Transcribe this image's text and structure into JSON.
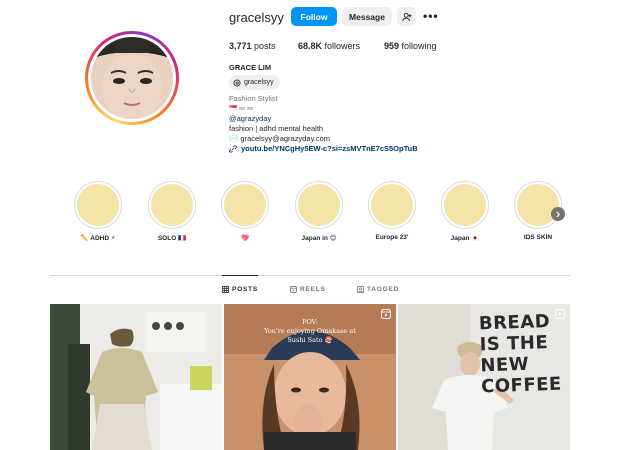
{
  "profile": {
    "username": "gracelsyy",
    "full_name": "GRACE LIM",
    "threads_handle": "gracelsyy",
    "category": "Fashion Stylist",
    "flag_emoji": "🇸🇬",
    "mention": "@agrazyday",
    "bio_line_1": "fashion | adhd mental health",
    "bio_line_2": "✉️ gracelsyy@agrazyday.com",
    "link": "youtu.be/YNCgHy5EW-c?si=zsMVTnE7cS5OpTuB"
  },
  "buttons": {
    "follow": "Follow",
    "message": "Message",
    "more": "•••"
  },
  "stats": {
    "posts_count": "3,771",
    "posts_label": " posts",
    "followers_count": "68.8K",
    "followers_label": " followers",
    "following_count": "959",
    "following_label": " following"
  },
  "highlights": [
    {
      "label": "✏️ ADHD ⚡"
    },
    {
      "label": "SOLO 🇫🇷"
    },
    {
      "label": "💖"
    },
    {
      "label": "Japan in 😊"
    },
    {
      "label": "Europe 23'"
    },
    {
      "label": "Japan 🇯🇵"
    },
    {
      "label": "IDS SKIN"
    }
  ],
  "tabs": {
    "posts": "POSTS",
    "reels": "REELS",
    "tagged": "TAGGED"
  },
  "posts": {
    "post_2_text_1": "POV:",
    "post_2_text_2": "You're enjoying Omakase at",
    "post_2_text_3": "Sushi Sato 🍣",
    "post_3_text_1": "BREAD",
    "post_3_text_2": "IS THE",
    "post_3_text_3": "NEW",
    "post_3_text_4": "COFFEE"
  },
  "colors": {
    "accent": "#0095f6",
    "highlight_fill": "#f5e4a8",
    "link": "#00376b"
  }
}
